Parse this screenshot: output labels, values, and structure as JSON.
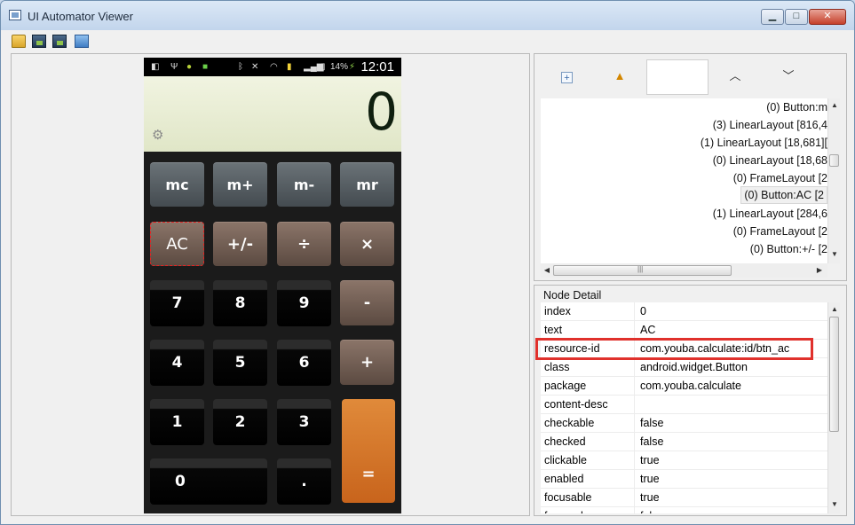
{
  "window": {
    "title": "UI Automator Viewer",
    "controls": {
      "minimize": "▁",
      "maximize": "□",
      "close": "✕"
    }
  },
  "toolbar": {
    "icons": [
      "folder-open-icon",
      "device-screenshot-icon",
      "device-screenshot-compressed-icon",
      "save-icon"
    ]
  },
  "phone": {
    "status_time": "12:01",
    "battery_pct": "14%",
    "display_value": "0",
    "keys": {
      "mc": "mc",
      "mplus": "m+",
      "mminus": "m-",
      "mr": "mr",
      "ac": "AC",
      "plusminus": "+/-",
      "divide": "÷",
      "multiply": "×",
      "k7": "7",
      "k8": "8",
      "k9": "9",
      "minus": "-",
      "k4": "4",
      "k5": "5",
      "k6": "6",
      "plus": "+",
      "k1": "1",
      "k2": "2",
      "k3": "3",
      "equals": "=",
      "k0": "0",
      "dot": "."
    }
  },
  "tree": {
    "rows": [
      "(0) Button:m",
      "(3) LinearLayout [816,4",
      "(1) LinearLayout [18,681][",
      "(0) LinearLayout [18,68",
      "(0) FrameLayout [2",
      "(0) Button:AC [2",
      "(1) LinearLayout [284,6",
      "(0) FrameLayout [2",
      "(0) Button:+/- [2"
    ],
    "hscroll_grip": "|||"
  },
  "node_detail": {
    "title": "Node Detail",
    "rows": [
      {
        "key": "index",
        "value": "0"
      },
      {
        "key": "text",
        "value": "AC"
      },
      {
        "key": "resource-id",
        "value": "com.youba.calculate:id/btn_ac"
      },
      {
        "key": "class",
        "value": "android.widget.Button"
      },
      {
        "key": "package",
        "value": "com.youba.calculate"
      },
      {
        "key": "content-desc",
        "value": ""
      },
      {
        "key": "checkable",
        "value": "false"
      },
      {
        "key": "checked",
        "value": "false"
      },
      {
        "key": "clickable",
        "value": "true"
      },
      {
        "key": "enabled",
        "value": "true"
      },
      {
        "key": "focusable",
        "value": "true"
      },
      {
        "key": "focused",
        "value": "false"
      }
    ]
  },
  "colors": {
    "highlight": "#e0312c",
    "equals_key": "#d57428",
    "display_bg": "#e8edd3"
  }
}
